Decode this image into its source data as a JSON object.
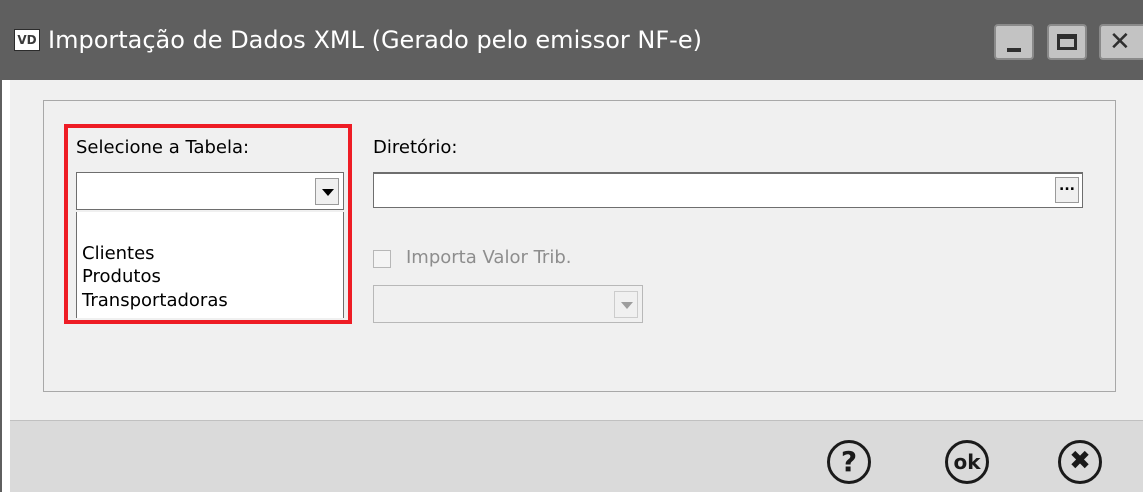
{
  "window": {
    "icon_text": "VD",
    "title": "Importação de Dados XML (Gerado pelo emissor NF-e)",
    "controls": {
      "minimize": "minimize-icon",
      "maximize": "maximize-icon",
      "close": "close-icon"
    }
  },
  "form": {
    "table_label": "Selecione a Tabela:",
    "table_selected": "",
    "table_options": [
      "Clientes",
      "Produtos",
      "Transportadoras"
    ],
    "directory_label": "Diretório:",
    "directory_value": "",
    "browse_button": "...",
    "import_checkbox_label": "Importa Valor Trib.",
    "import_checkbox_checked": false,
    "secondary_combo_value": ""
  },
  "footer": {
    "help_button": "?",
    "ok_button": "ok",
    "cancel_button": "✖"
  },
  "colors": {
    "titlebar": "#5f5f5f",
    "highlight": "#ee1c25",
    "window_bg": "#f0f0f0"
  }
}
